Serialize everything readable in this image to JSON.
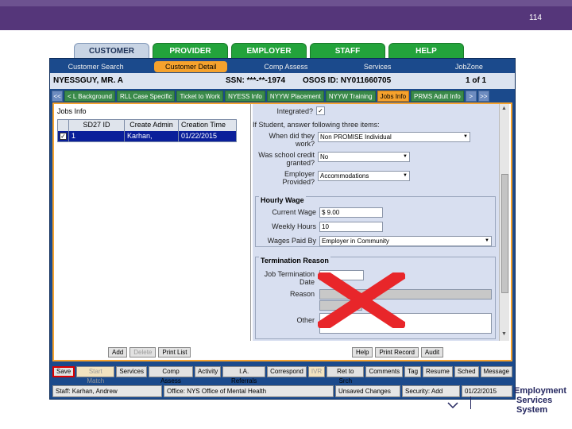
{
  "slide_number": "114",
  "main_tabs": [
    {
      "label": "CUSTOMER",
      "active": true
    },
    {
      "label": "PROVIDER",
      "active": false
    },
    {
      "label": "EMPLOYER",
      "active": false
    },
    {
      "label": "STAFF",
      "active": false
    },
    {
      "label": "HELP",
      "active": false
    }
  ],
  "subnav": [
    "Customer Search",
    "Customer Detail",
    "Comp Assess",
    "Services",
    "JobZone"
  ],
  "header": {
    "name": "NYESSGUY, MR. A",
    "ssn": "SSN: ***-**-1974",
    "osos": "OSOS ID: NY011660705",
    "page": "1 of 1"
  },
  "content_tabs": [
    "<<",
    "< L Background",
    "RLL Case Specific",
    "Ticket to Work",
    "NYESS Info",
    "NYYW Placement",
    "NYYW Training",
    "Jobs Info",
    "PRMS Adult Info",
    ">",
    ">>"
  ],
  "jobs": {
    "title": "Jobs Info",
    "columns": [
      "",
      "SD27 ID",
      "Create Admin",
      "Creation Time"
    ],
    "rows": [
      {
        "checked": "✓",
        "id": "1",
        "admin": "Karhan, Andrew",
        "time": "01/22/2015"
      }
    ]
  },
  "form": {
    "integrated_label": "Integrated?",
    "student_note": "If Student, answer following three items:",
    "when_label": "When did they work?",
    "when_value": "Non PROMISE Individual",
    "credit_label": "Was school credit granted?",
    "credit_value": "No",
    "employer_label": "Employer Provided?",
    "employer_value": "Accommodations",
    "hourly_legend": "Hourly Wage",
    "current_wage_label": "Current Wage",
    "current_wage_value": "$ 9.00",
    "weekly_hours_label": "Weekly Hours",
    "weekly_hours_value": "10",
    "wages_paid_label": "Wages Paid By",
    "wages_paid_value": "Employer in Community",
    "termination_legend": "Termination Reason",
    "term_date_label": "Job Termination Date",
    "reason_label": "Reason",
    "other_label": "Other"
  },
  "list_buttons": [
    "Add",
    "Delete",
    "Print List"
  ],
  "action_buttons": [
    "Help",
    "Print Record",
    "Audit"
  ],
  "bottom_buttons": [
    "Save",
    "Start Match",
    "Services",
    "Comp Assess",
    "Activity",
    "I.A. Referrals",
    "Correspond",
    "IVR",
    "Ret to Srch",
    "Comments",
    "Tag",
    "Resume",
    "Sched",
    "Message"
  ],
  "status_bar": {
    "staff": "Staff: Karhan, Andrew",
    "office": "Office: NYS Office of Mental Health",
    "unsaved": "Unsaved Changes",
    "security": "Security: Add",
    "date": "01/22/2015"
  },
  "logo": {
    "line1": "Employment",
    "line2": "Services System"
  },
  "colors": {
    "purple_bar": "#55367a",
    "tab_green": "#23a33b",
    "app_blue": "#1b4a8c",
    "accent_orange": "#f5a22d",
    "selection_blue": "#0a1f9a",
    "red_x": "#e8262a"
  }
}
